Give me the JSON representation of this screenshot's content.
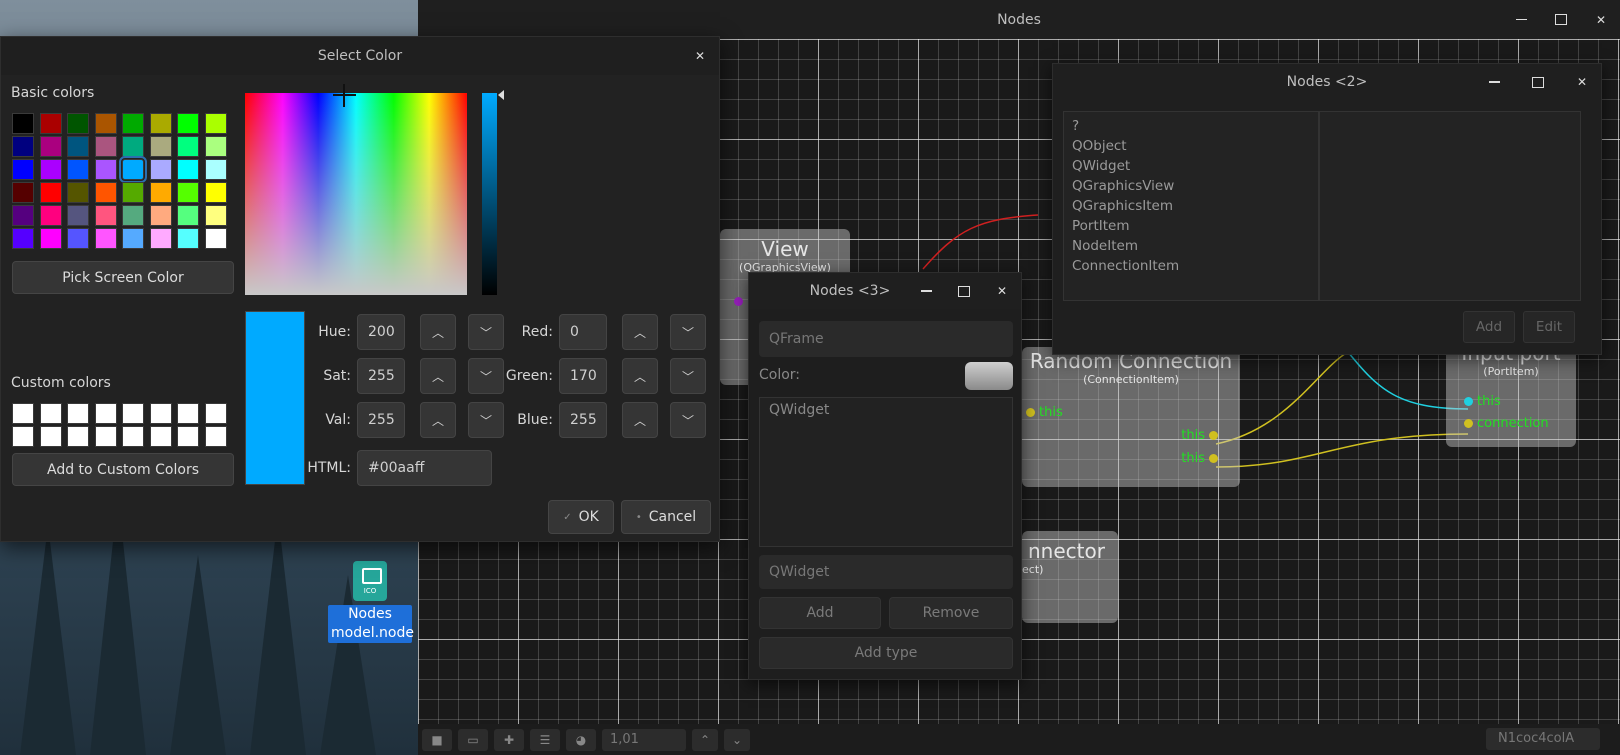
{
  "main_window": {
    "title": "Nodes",
    "status_coords": "1,01",
    "status_right": "N1coc4colA"
  },
  "desktop_icon": {
    "label_line1": "Nodes",
    "label_line2": "model.node",
    "badge": "ICO"
  },
  "canvas_nodes": {
    "view": {
      "title": "View",
      "subtitle": "(QGraphicsView)"
    },
    "random_connection": {
      "title": "Random Connection",
      "subtitle": "(ConnectionItem)",
      "in_port": "this",
      "out_port_1": "this",
      "out_port_2": "this"
    },
    "connector": {
      "title": "nnector",
      "subtitle": "ect)"
    },
    "input_port": {
      "title": "Input port",
      "subtitle": "(PortItem)",
      "port_1": "this",
      "port_2": "connection"
    }
  },
  "nodes2": {
    "title": "Nodes <2>",
    "items": [
      "?",
      "QObject",
      "QWidget",
      "QGraphicsView",
      "QGraphicsItem",
      "PortItem",
      "NodeItem",
      "ConnectionItem"
    ],
    "add_label": "Add",
    "edit_label": "Edit"
  },
  "nodes3": {
    "title": "Nodes <3>",
    "type_field": "QFrame",
    "color_label": "Color:",
    "list_item": "QWidget",
    "type_input": "QWidget",
    "add_label": "Add",
    "remove_label": "Remove",
    "add_type_label": "Add type"
  },
  "color_dialog": {
    "title": "Select Color",
    "basic_colors_label": "Basic colors",
    "basic_colors": [
      "#000000",
      "#aa0000",
      "#005500",
      "#aa5500",
      "#00aa00",
      "#aaaa00",
      "#00ff00",
      "#aaff00",
      "#00007f",
      "#aa007f",
      "#00557f",
      "#aa557f",
      "#00aa7f",
      "#aaaa7f",
      "#00ff7f",
      "#aaff7f",
      "#0000ff",
      "#aa00ff",
      "#0055ff",
      "#aa55ff",
      "#00aaff",
      "#aaaaff",
      "#00ffff",
      "#aaffff",
      "#550000",
      "#ff0000",
      "#555500",
      "#ff5500",
      "#55aa00",
      "#ffaa00",
      "#55ff00",
      "#ffff00",
      "#55007f",
      "#ff007f",
      "#55557f",
      "#ff557f",
      "#55aa7f",
      "#ffaa7f",
      "#55ff7f",
      "#ffff7f",
      "#5500ff",
      "#ff00ff",
      "#5555ff",
      "#ff55ff",
      "#55aaff",
      "#ffaaff",
      "#55ffff",
      "#ffffff"
    ],
    "selected_basic_color": "#00aaff",
    "pick_screen_label": "Pick Screen Color",
    "custom_colors_label": "Custom colors",
    "custom_colors": [
      "#ffffff",
      "#ffffff",
      "#ffffff",
      "#ffffff",
      "#ffffff",
      "#ffffff",
      "#ffffff",
      "#ffffff",
      "#ffffff",
      "#ffffff",
      "#ffffff",
      "#ffffff",
      "#ffffff",
      "#ffffff",
      "#ffffff",
      "#ffffff"
    ],
    "add_custom_label": "Add to Custom Colors",
    "current_color": "#00aaff",
    "hue_label": "Hue:",
    "hue": "200",
    "sat_label": "Sat:",
    "sat": "255",
    "val_label": "Val:",
    "val": "255",
    "red_label": "Red:",
    "red": "0",
    "green_label": "Green:",
    "green": "170",
    "blue_label": "Blue:",
    "blue": "255",
    "html_label": "HTML:",
    "html": "#00aaff",
    "ok_label": "OK",
    "cancel_label": "Cancel"
  }
}
